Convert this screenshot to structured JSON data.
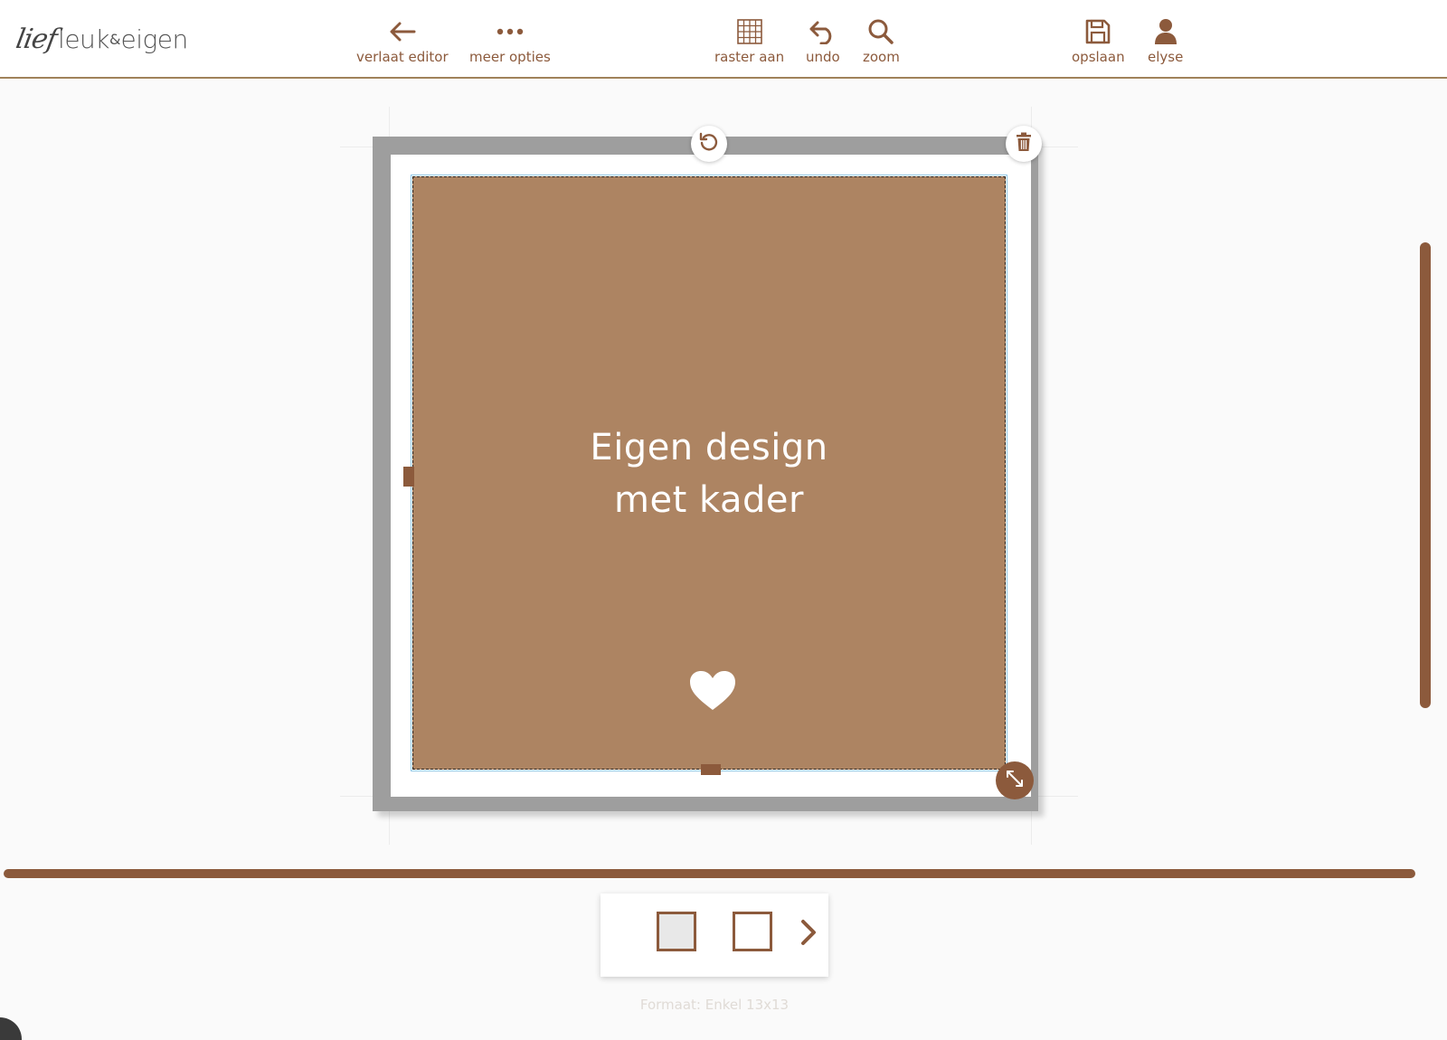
{
  "header": {
    "logo": {
      "script": "lief",
      "brand": "leuk",
      "amp": "&",
      "brand2": "eigen"
    },
    "tools": {
      "leave": {
        "label": "verlaat editor",
        "icon": "arrow-left-icon"
      },
      "more": {
        "label": "meer opties",
        "icon": "more-dots-icon"
      },
      "grid": {
        "label": "raster aan",
        "icon": "grid-icon"
      },
      "undo": {
        "label": "undo",
        "icon": "undo-icon"
      },
      "zoom": {
        "label": "zoom",
        "icon": "search-icon"
      },
      "save": {
        "label": "opslaan",
        "icon": "save-icon"
      },
      "user": {
        "label": "elyse",
        "icon": "user-icon"
      }
    }
  },
  "canvas": {
    "design_line1": "Eigen design",
    "design_line2": "met kader",
    "design_color": "#ad8462",
    "frame_color": "#9e9e9e"
  },
  "footer": {
    "format": "Formaat: Enkel 13x13"
  },
  "colors": {
    "accent": "#8c5a3c"
  }
}
